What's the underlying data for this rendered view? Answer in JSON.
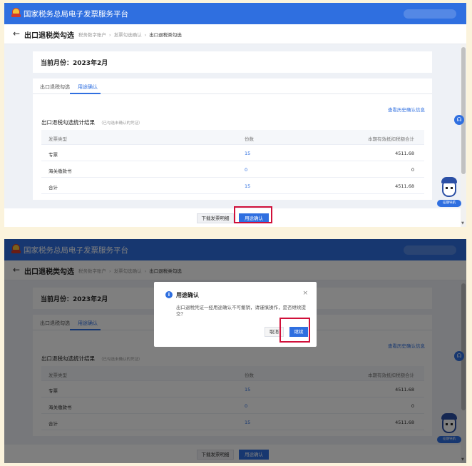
{
  "app": {
    "title": "国家税务总局电子发票服务平台"
  },
  "page": {
    "title": "出口退税类勾选",
    "breadcrumbs": [
      "税务数字账户",
      "发票勾选确认",
      "出口退税类勾选"
    ],
    "month_text": "当前月份：2023年2月"
  },
  "tabs": [
    {
      "label": "出口退税勾选",
      "active": false
    },
    {
      "label": "用途确认",
      "active": true
    }
  ],
  "history_link": "查看历史确认信息",
  "stats": {
    "title": "出口退税勾选统计结果",
    "hint": "（已勾选未确认的凭证）",
    "columns": [
      "发票类型",
      "份数",
      "本期有效抵扣税额合计"
    ],
    "rows": [
      {
        "type": "专票",
        "count": "15",
        "tax": "4511.68"
      },
      {
        "type": "海关缴款书",
        "count": "0",
        "tax": "0"
      },
      {
        "type": "合计",
        "count": "15",
        "tax": "4511.68"
      }
    ]
  },
  "footer": {
    "download_label": "下载发票明细",
    "confirm_label": "用途确认"
  },
  "assistant": {
    "label": "征期导航",
    "help_icon": "headset-icon"
  },
  "dialog": {
    "title": "用途确认",
    "message": "出口退税凭证一经用途确认不可撤销，请谨慎操作，是否继续提交？",
    "cancel_label": "取消",
    "continue_label": "继续",
    "close_glyph": "×",
    "info_glyph": "i"
  },
  "colors": {
    "brand": "#2f6fe0",
    "highlight": "#d0103a"
  }
}
